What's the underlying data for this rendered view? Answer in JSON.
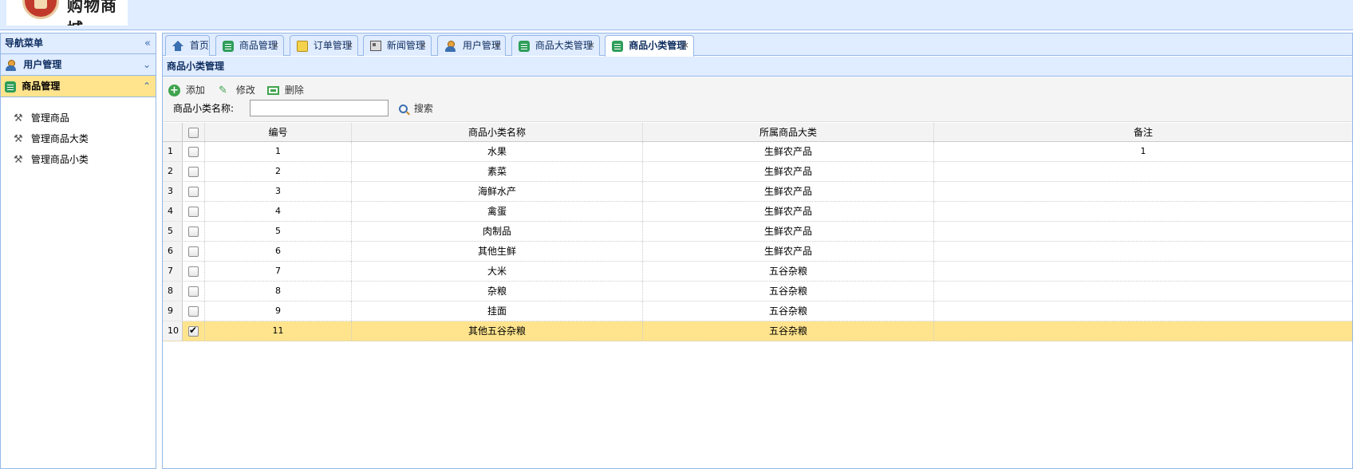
{
  "logo": {
    "text": "购物商城"
  },
  "nav": {
    "title": "导航菜单",
    "collapse_icon": "double-chevron-left-icon",
    "sections": [
      {
        "label": "用户管理",
        "icon": "user-icon",
        "expand_icon": "double-chevron-down-icon",
        "selected": false
      },
      {
        "label": "商品管理",
        "icon": "list-icon",
        "expand_icon": "double-chevron-up-icon",
        "selected": true
      }
    ],
    "items": [
      {
        "label": "管理商品",
        "icon": "wrench-icon"
      },
      {
        "label": "管理商品大类",
        "icon": "wrench-icon"
      },
      {
        "label": "管理商品小类",
        "icon": "wrench-icon"
      }
    ]
  },
  "tabs": [
    {
      "label": "首页",
      "icon": "home-icon",
      "closable": false,
      "selected": false
    },
    {
      "label": "商品管理",
      "icon": "list-icon",
      "closable": true,
      "selected": false
    },
    {
      "label": "订单管理",
      "icon": "order-icon",
      "closable": true,
      "selected": false
    },
    {
      "label": "新闻管理",
      "icon": "news-icon",
      "closable": true,
      "selected": false
    },
    {
      "label": "用户管理",
      "icon": "user-icon",
      "closable": true,
      "selected": false
    },
    {
      "label": "商品大类管理",
      "icon": "list-icon",
      "closable": true,
      "selected": false
    },
    {
      "label": "商品小类管理",
      "icon": "list-icon",
      "closable": true,
      "selected": true
    }
  ],
  "tab_close_glyph": "×",
  "panel": {
    "title": "商品小类管理"
  },
  "toolbar": {
    "add_label": "添加",
    "edit_label": "修改",
    "delete_label": "删除",
    "search_label": "商品小类名称:",
    "search_value": "",
    "search_button": "搜索"
  },
  "grid": {
    "columns": [
      "编号",
      "商品小类名称",
      "所属商品大类",
      "备注"
    ],
    "rows": [
      {
        "num": "1",
        "id": "1",
        "name": "水果",
        "category": "生鲜农产品",
        "remark": "1",
        "checked": false
      },
      {
        "num": "2",
        "id": "2",
        "name": "素菜",
        "category": "生鲜农产品",
        "remark": "",
        "checked": false
      },
      {
        "num": "3",
        "id": "3",
        "name": "海鲜水产",
        "category": "生鲜农产品",
        "remark": "",
        "checked": false
      },
      {
        "num": "4",
        "id": "4",
        "name": "禽蛋",
        "category": "生鲜农产品",
        "remark": "",
        "checked": false
      },
      {
        "num": "5",
        "id": "5",
        "name": "肉制品",
        "category": "生鲜农产品",
        "remark": "",
        "checked": false
      },
      {
        "num": "6",
        "id": "6",
        "name": "其他生鲜",
        "category": "生鲜农产品",
        "remark": "",
        "checked": false
      },
      {
        "num": "7",
        "id": "7",
        "name": "大米",
        "category": "五谷杂粮",
        "remark": "",
        "checked": false
      },
      {
        "num": "8",
        "id": "8",
        "name": "杂粮",
        "category": "五谷杂粮",
        "remark": "",
        "checked": false
      },
      {
        "num": "9",
        "id": "9",
        "name": "挂面",
        "category": "五谷杂粮",
        "remark": "",
        "checked": false
      },
      {
        "num": "10",
        "id": "11",
        "name": "其他五谷杂粮",
        "category": "五谷杂粮",
        "remark": "",
        "checked": true
      }
    ]
  },
  "colors": {
    "header_bg": "#e0ecff",
    "border": "#95b8e7",
    "selected_row": "#ffe48d",
    "accent_green": "#3fa34d"
  }
}
